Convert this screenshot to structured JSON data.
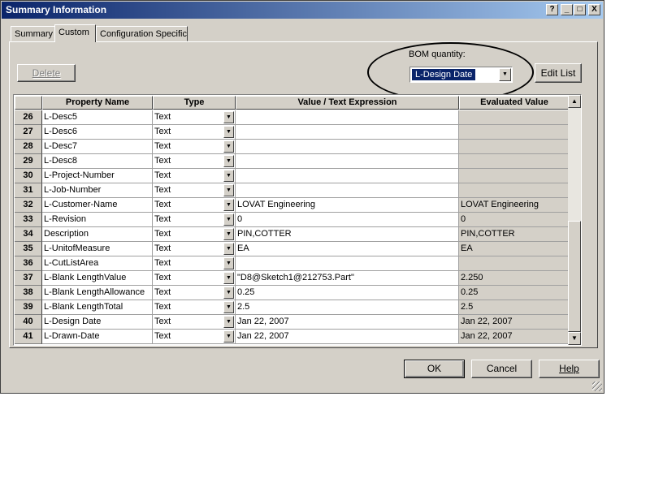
{
  "window": {
    "title": "Summary Information"
  },
  "title_buttons": {
    "help": "?",
    "minimize": "_",
    "maximize": "□",
    "close": "X"
  },
  "tabs": [
    {
      "label": "Summary",
      "active": false
    },
    {
      "label": "Custom",
      "active": true
    },
    {
      "label": "Configuration Specific",
      "active": false
    }
  ],
  "toolbar": {
    "delete_label": "Delete",
    "edit_list_label": "Edit List"
  },
  "bom": {
    "label": "BOM quantity:",
    "value": "L-Design Date"
  },
  "columns": [
    "Property Name",
    "Type",
    "Value / Text Expression",
    "Evaluated Value"
  ],
  "rows": [
    {
      "num": "26",
      "name": "L-Desc5",
      "type": "Text",
      "value": "",
      "evaluated": ""
    },
    {
      "num": "27",
      "name": "L-Desc6",
      "type": "Text",
      "value": "",
      "evaluated": ""
    },
    {
      "num": "28",
      "name": "L-Desc7",
      "type": "Text",
      "value": "",
      "evaluated": ""
    },
    {
      "num": "29",
      "name": "L-Desc8",
      "type": "Text",
      "value": "",
      "evaluated": ""
    },
    {
      "num": "30",
      "name": "L-Project-Number",
      "type": "Text",
      "value": "",
      "evaluated": ""
    },
    {
      "num": "31",
      "name": "L-Job-Number",
      "type": "Text",
      "value": "",
      "evaluated": ""
    },
    {
      "num": "32",
      "name": "L-Customer-Name",
      "type": "Text",
      "value": "LOVAT Engineering",
      "evaluated": "LOVAT Engineering"
    },
    {
      "num": "33",
      "name": "L-Revision",
      "type": "Text",
      "value": "0",
      "evaluated": "0"
    },
    {
      "num": "34",
      "name": "Description",
      "type": "Text",
      "value": "PIN,COTTER",
      "evaluated": "PIN,COTTER"
    },
    {
      "num": "35",
      "name": "L-UnitofMeasure",
      "type": "Text",
      "value": "EA",
      "evaluated": "EA"
    },
    {
      "num": "36",
      "name": "L-CutListArea",
      "type": "Text",
      "value": "",
      "evaluated": ""
    },
    {
      "num": "37",
      "name": "L-Blank LengthValue",
      "type": "Text",
      "value": "\"D8@Sketch1@212753.Part\"",
      "evaluated": "2.250"
    },
    {
      "num": "38",
      "name": "L-Blank LengthAllowance",
      "type": "Text",
      "value": "0.25",
      "evaluated": "0.25"
    },
    {
      "num": "39",
      "name": "L-Blank LengthTotal",
      "type": "Text",
      "value": "2.5",
      "evaluated": "2.5"
    },
    {
      "num": "40",
      "name": "L-Design Date",
      "type": "Text",
      "value": "Jan 22, 2007",
      "evaluated": "Jan 22, 2007"
    },
    {
      "num": "41",
      "name": "L-Drawn-Date",
      "type": "Text",
      "value": "Jan 22, 2007",
      "evaluated": "Jan 22, 2007"
    }
  ],
  "footer": {
    "ok_label": "OK",
    "cancel_label": "Cancel",
    "help_label": "Help"
  }
}
